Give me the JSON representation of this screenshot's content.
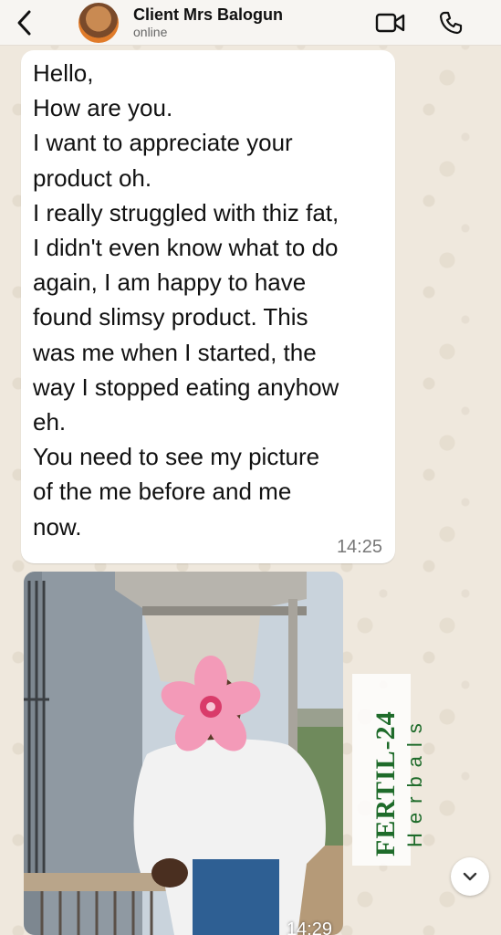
{
  "header": {
    "contact_name": "Client Mrs Balogun",
    "status": "online",
    "back_icon": "chevron-left-icon",
    "video_icon": "video-camera-icon",
    "call_icon": "phone-icon"
  },
  "message": {
    "lines": [
      "Hello,",
      "How are you.",
      "I want to appreciate your",
      "product oh.",
      "I really struggled with thiz fat,",
      "I didn't even know what to do",
      "again, I am happy to have",
      "found slimsy product. This",
      "was me when I started, the",
      "way I stopped eating anyhow",
      "eh.",
      "You need to see my picture",
      "of the me before and me",
      "now."
    ],
    "time": "14:25"
  },
  "image_message": {
    "time": "14:29"
  },
  "watermark": {
    "brand": "FERTIL-24",
    "sub": "Herbals",
    "color": "#1e6b2a"
  },
  "scroll_down": {
    "icon": "chevron-down-icon"
  },
  "colors": {
    "header_bg": "#f7f5f2",
    "bubble_bg": "#ffffff",
    "wallpaper": "#efe8dd"
  }
}
